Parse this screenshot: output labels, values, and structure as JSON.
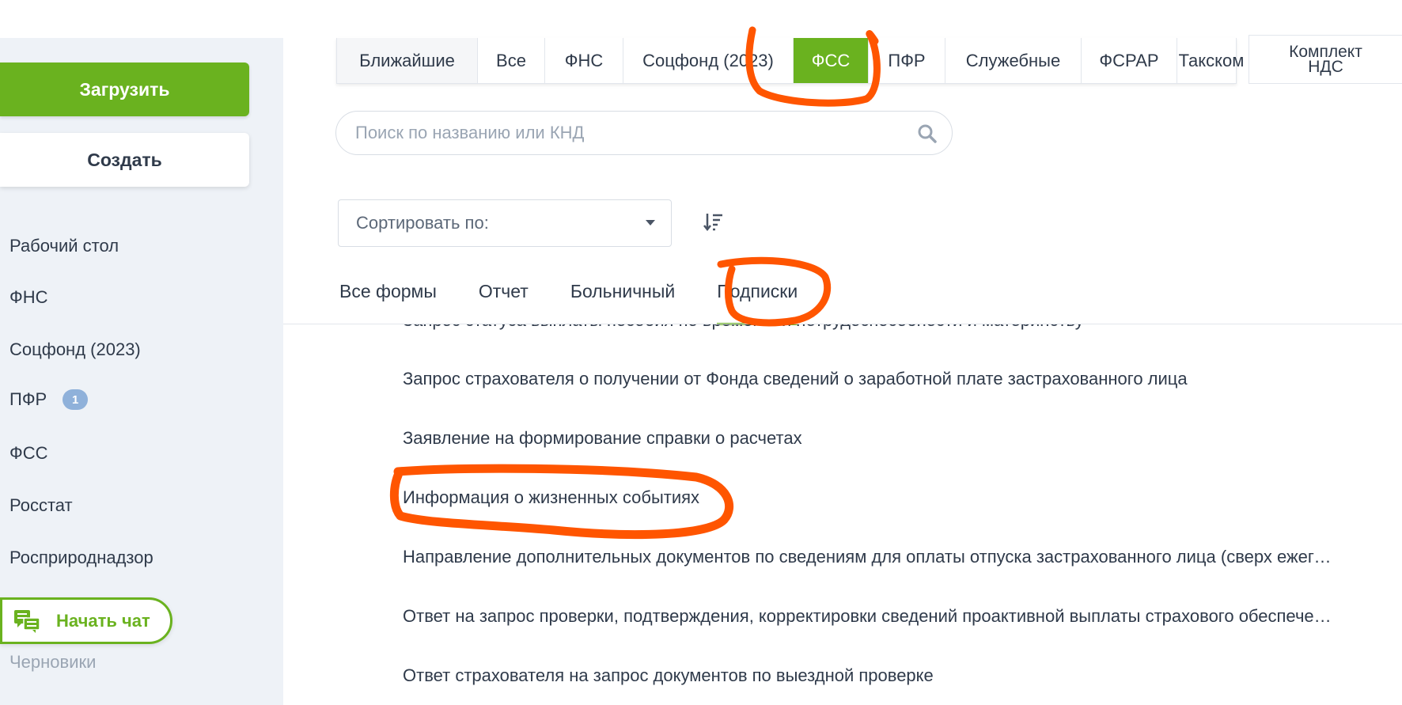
{
  "sidebar": {
    "upload_label": "Загрузить",
    "create_label": "Создать",
    "items": [
      {
        "label": "Рабочий стол"
      },
      {
        "label": "ФНС"
      },
      {
        "label": "Соцфонд (2023)"
      },
      {
        "label": "ПФР",
        "badge": "1"
      },
      {
        "label": "ФСС"
      },
      {
        "label": "Росстат"
      },
      {
        "label": "Росприроднадзор"
      }
    ],
    "drafts_label": "Черновики",
    "chat_label": "Начать чат"
  },
  "top_tabs": [
    {
      "label": "Ближайшие"
    },
    {
      "label": "Все"
    },
    {
      "label": "ФНС"
    },
    {
      "label": "Соцфонд (2023)"
    },
    {
      "label": "ФСС",
      "active": true
    },
    {
      "label": "ПФР"
    },
    {
      "label": "Служебные"
    },
    {
      "label": "ФСРАР"
    },
    {
      "label": "Такском"
    }
  ],
  "komplekt": {
    "line1": "Комплект",
    "line2": "НДС"
  },
  "search": {
    "placeholder": "Поиск по названию или КНД"
  },
  "sort": {
    "label": "Сортировать по:"
  },
  "sub_tabs": [
    {
      "label": "Все формы"
    },
    {
      "label": "Отчет"
    },
    {
      "label": "Больничный"
    },
    {
      "label": "Подписки",
      "active": true
    }
  ],
  "forms": [
    "Запрос статуса выплаты пособия по временной нетрудоспособности и материнству",
    "Запрос страхователя о получении от Фонда сведений о заработной плате застрахованного лица",
    "Заявление на формирование справки о расчетах",
    "Информация о жизненных событиях",
    "Направление дополнительных документов по сведениям для оплаты отпуска застрахованного лица (сверх ежегодного оплачиваемого отпуска)",
    "Ответ на запрос проверки, подтверждения, корректировки сведений проактивной выплаты страхового обеспечения",
    "Ответ страхователя на запрос документов по выездной проверке"
  ],
  "colors": {
    "accent": "#6ab21f",
    "annotation": "#ff5500",
    "badge": "#8fb1da"
  }
}
